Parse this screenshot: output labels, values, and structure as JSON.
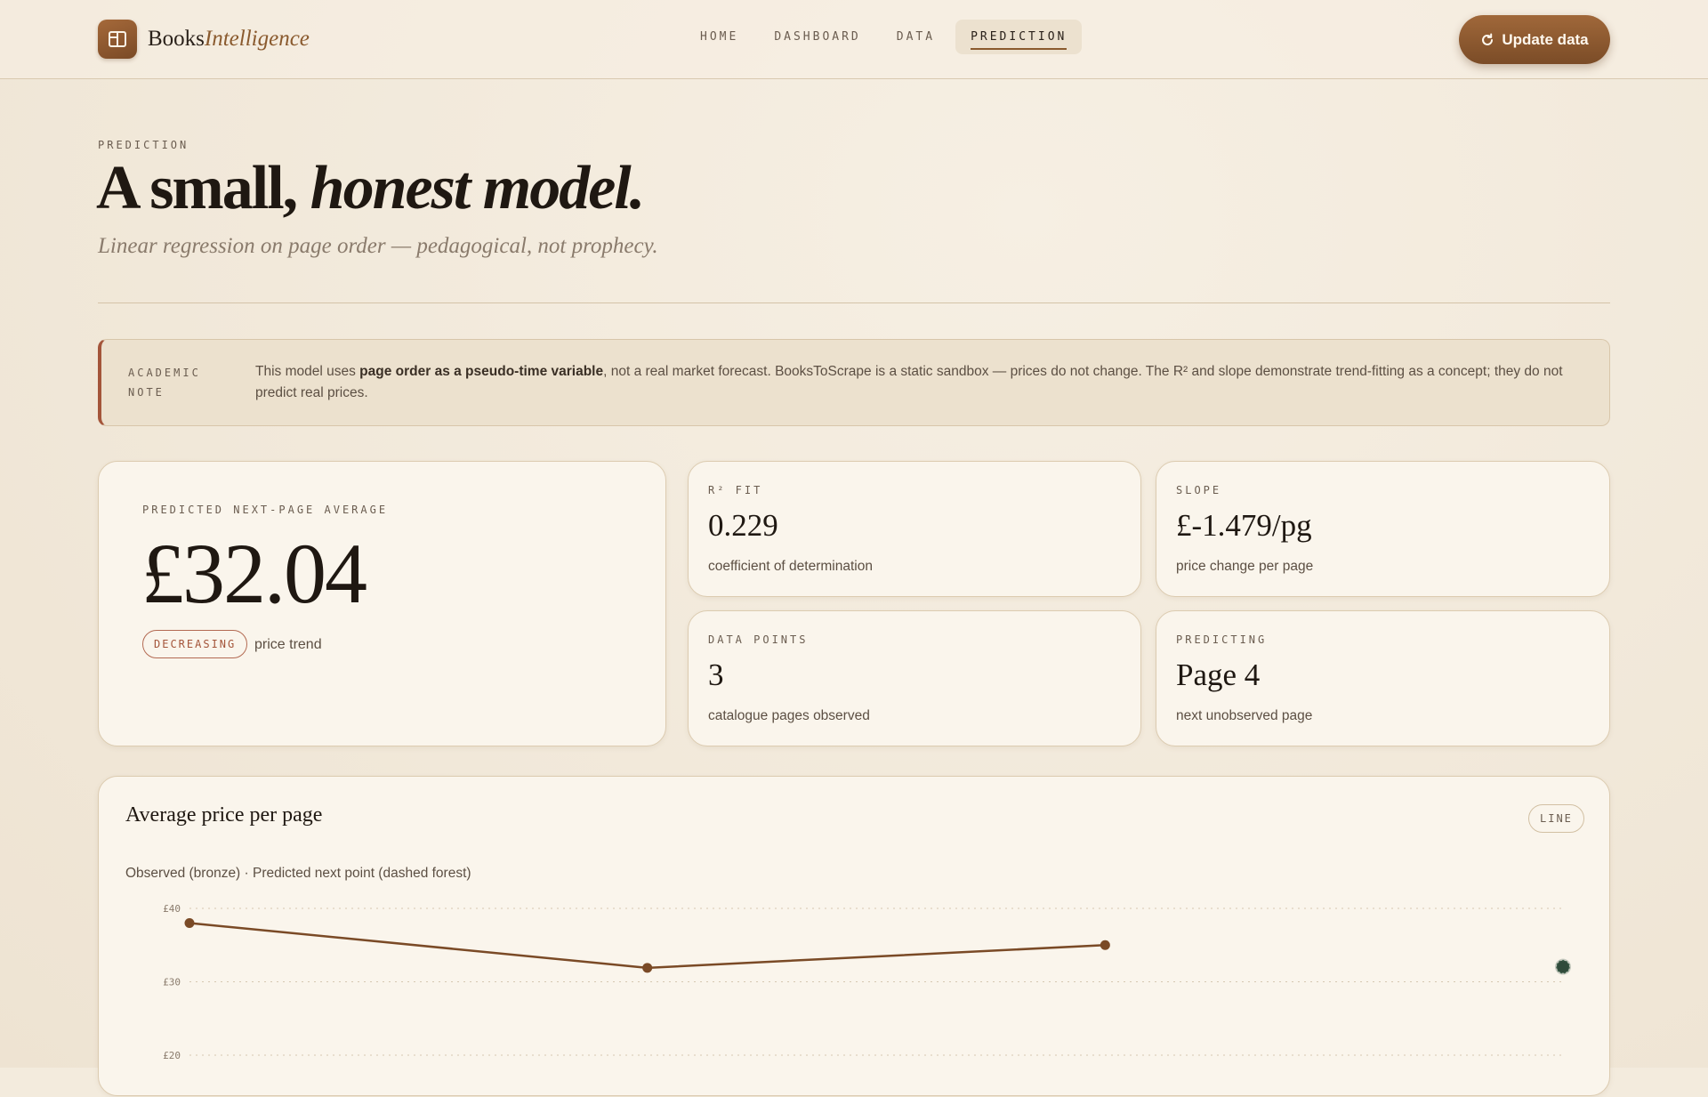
{
  "brand": {
    "name_plain": "Books",
    "name_italic": "Intelligence",
    "icon": "book-open-icon"
  },
  "nav": {
    "items": [
      {
        "label": "HOME"
      },
      {
        "label": "DASHBOARD"
      },
      {
        "label": "DATA"
      },
      {
        "label": "PREDICTION",
        "active": true
      }
    ]
  },
  "update_button": {
    "label": "Update data",
    "icon": "refresh-icon"
  },
  "header": {
    "eyebrow": "PREDICTION",
    "title_plain": "A small,",
    "title_italic": "honest model.",
    "subtitle": "Linear regression on page order — pedagogical, not prophecy."
  },
  "note": {
    "label": "ACADEMIC NOTE",
    "text_before": "This model uses ",
    "text_bold": "page order as a pseudo-time variable",
    "text_after": ", not a real market forecast. BooksToScrape is a static sandbox — prices do not change. The R² and slope demonstrate trend-fitting as a concept; they do not predict real prices."
  },
  "prediction": {
    "eyebrow": "PREDICTED NEXT-PAGE AVERAGE",
    "value": "£32.04",
    "trend_badge": "DECREASING",
    "trend_label": "price trend"
  },
  "stats": {
    "r2": {
      "eyebrow": "R² FIT",
      "value": "0.229",
      "desc": "coefficient of determination"
    },
    "slope": {
      "eyebrow": "SLOPE",
      "value": "£-1.479/pg",
      "desc": "price change per page"
    },
    "points": {
      "eyebrow": "DATA POINTS",
      "value": "3",
      "desc": "catalogue pages observed"
    },
    "predicting": {
      "eyebrow": "PREDICTING",
      "value": "Page 4",
      "desc": "next unobserved page"
    }
  },
  "chart": {
    "title": "Average price per page",
    "type_badge": "LINE",
    "subtitle": "Observed (bronze) · Predicted next point (dashed forest)"
  },
  "colors": {
    "accent": "#7b4c27",
    "observed": "#7a4a26",
    "predicted": "#2f4a3a",
    "trend_badge": "#a4553a"
  },
  "chart_data": {
    "type": "line",
    "x": [
      1,
      2,
      3,
      4
    ],
    "ylim": [
      20,
      40
    ],
    "yticks": [
      40,
      30,
      20
    ],
    "ytick_labels": [
      "£40",
      "£30",
      "£20"
    ],
    "grid": true,
    "series": [
      {
        "name": "Observed",
        "x": [
          1,
          2,
          3
        ],
        "values": [
          38.0,
          31.9,
          35.0
        ]
      },
      {
        "name": "Predicted",
        "x": [
          4
        ],
        "values": [
          32.04
        ]
      }
    ]
  }
}
